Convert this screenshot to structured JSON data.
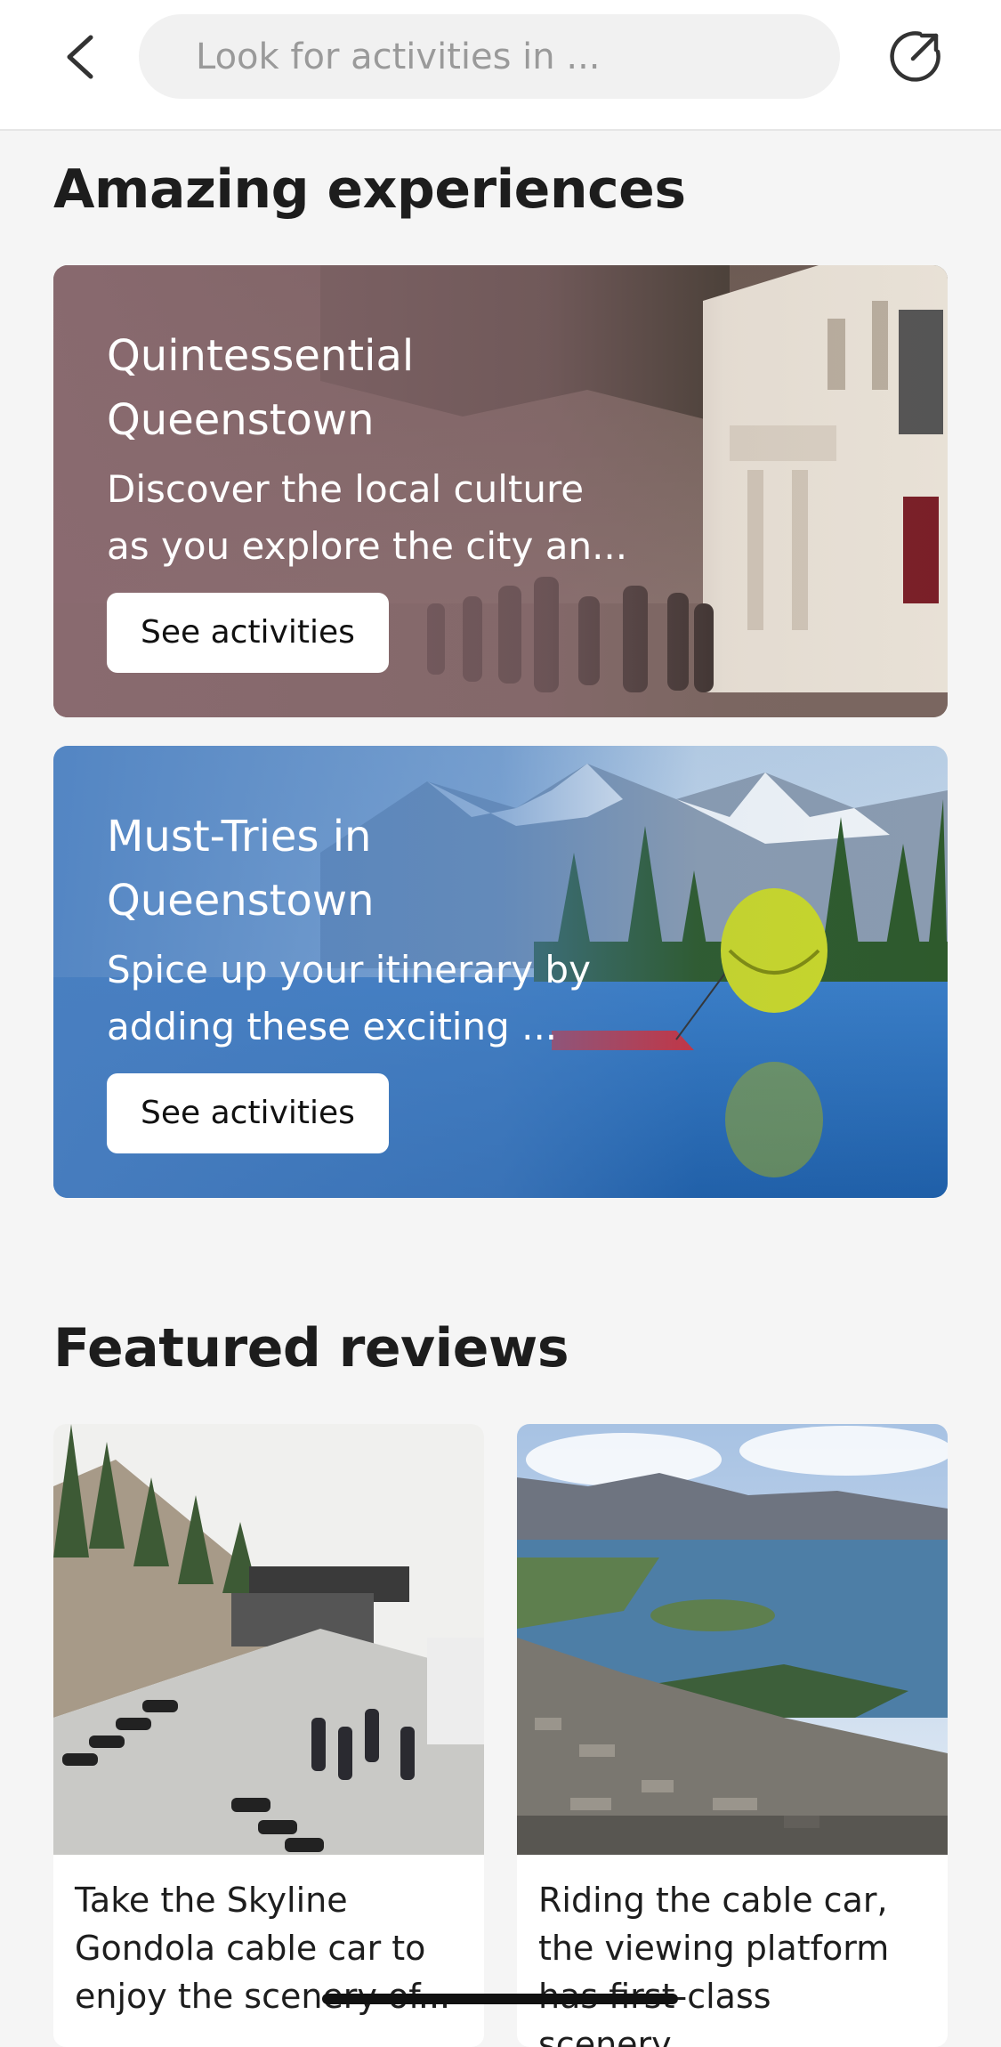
{
  "header": {
    "search_placeholder": "Look for activities in ...",
    "back_icon": "chevron-left-icon",
    "share_icon": "share-out-icon"
  },
  "sections": {
    "experiences_title": "Amazing experiences",
    "reviews_title": "Featured reviews"
  },
  "experiences": [
    {
      "title_line1": "Quintessential",
      "title_line2": "Queenstown",
      "desc_line1": "Discover the local culture",
      "desc_line2": "as you explore the city an...",
      "button": "See activities"
    },
    {
      "title_line1": "Must-Tries in",
      "title_line2": "Queenstown",
      "desc_line1": "Spice up your itinerary by",
      "desc_line2": "adding these exciting ...",
      "button": "See activities"
    }
  ],
  "reviews": [
    {
      "line1": "Take the Skyline",
      "line2": "Gondola cable car to",
      "line3": "enjoy the scenery of..."
    },
    {
      "line1": "Riding the cable car,",
      "line2": "the viewing platform",
      "line3": "has first-class scenery..."
    }
  ],
  "colors": {
    "card1_tint": "#8a6a70",
    "card2_tint": "#4a7fc0",
    "accent_text": "#ffffff"
  }
}
